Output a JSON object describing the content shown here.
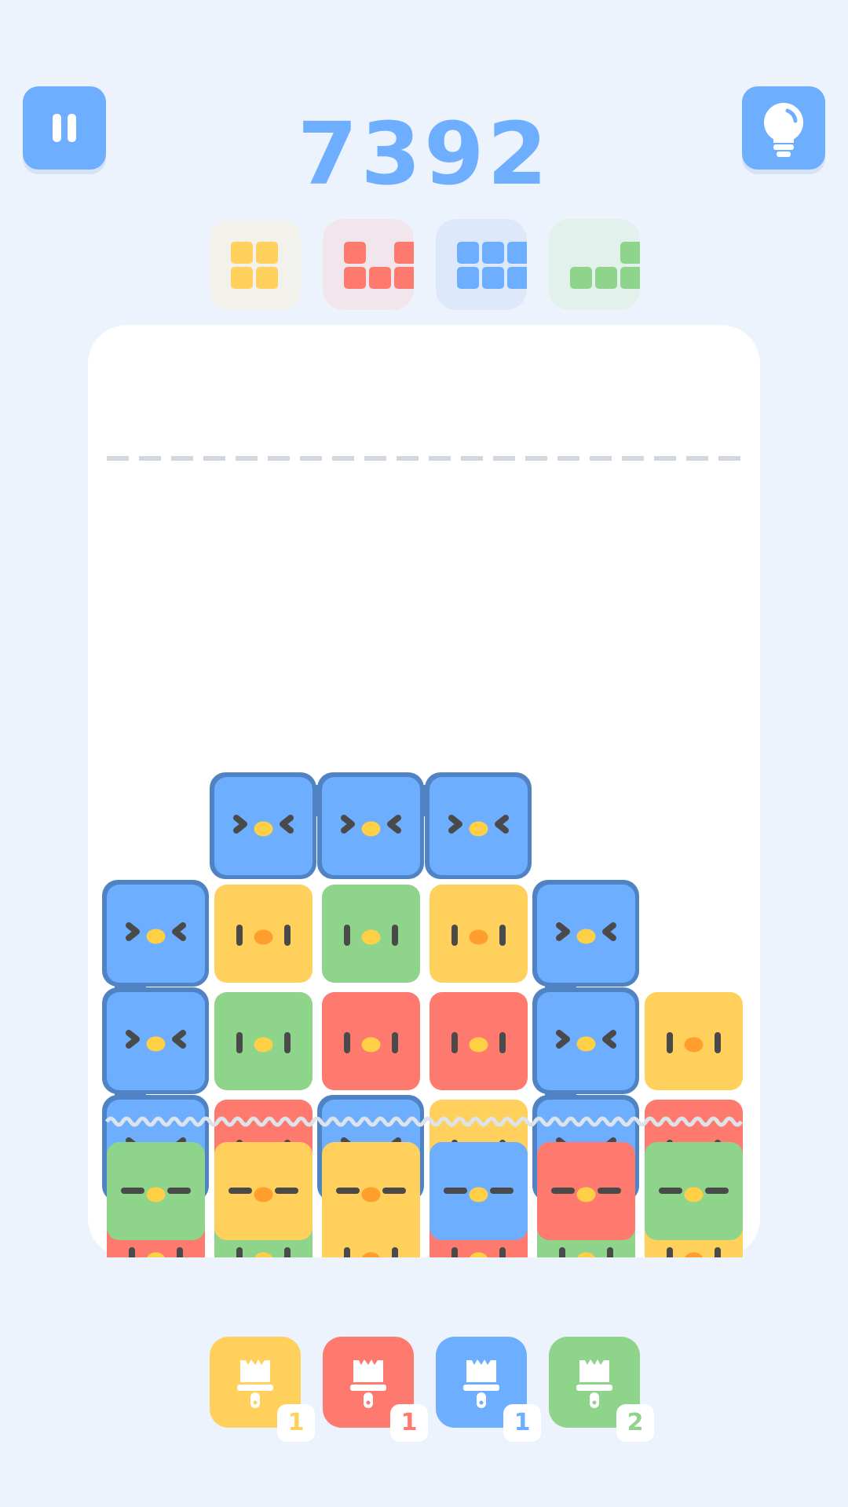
{
  "score": "7392",
  "colors": {
    "yellow": "#ffd05c",
    "red": "#ff7a6e",
    "blue": "#6eaeff",
    "green": "#8ed48a",
    "outline": "#4f83c4",
    "face": "#4a4a4a",
    "nose_yellow": "#ffd045",
    "nose_orange": "#ff9e2c"
  },
  "goals": [
    {
      "name": "yellow",
      "color": "#ffd05c",
      "bg": "#f2f1ec",
      "pattern": [
        [
          1,
          1,
          0
        ],
        [
          1,
          1,
          0
        ]
      ]
    },
    {
      "name": "red",
      "color": "#ff7a6e",
      "bg": "#f0e6ec",
      "pattern": [
        [
          1,
          0,
          1
        ],
        [
          1,
          1,
          1
        ]
      ]
    },
    {
      "name": "blue",
      "color": "#6eaeff",
      "bg": "#dde9fa",
      "pattern": [
        [
          1,
          1,
          1
        ],
        [
          1,
          1,
          1
        ]
      ]
    },
    {
      "name": "green",
      "color": "#8ed48a",
      "bg": "#e3f1ec",
      "pattern": [
        [
          0,
          0,
          1
        ],
        [
          1,
          1,
          1
        ]
      ]
    }
  ],
  "board": {
    "grid": [
      [
        null,
        null,
        null,
        null,
        null,
        null
      ],
      [
        null,
        null,
        null,
        null,
        null,
        null
      ],
      [
        null,
        null,
        null,
        null,
        null,
        null
      ],
      [
        null,
        "B",
        "B",
        "B",
        null,
        null
      ],
      [
        "B",
        "Y",
        "G",
        "Y",
        "B",
        null
      ],
      [
        "B",
        "G",
        "R",
        "R",
        "B",
        "Y"
      ],
      [
        "B",
        "R",
        "B",
        "Y",
        "B",
        "R"
      ],
      [
        "R",
        "G",
        "Y",
        "R",
        "G",
        "Y"
      ]
    ],
    "next_row": [
      "G",
      "Y",
      "Y",
      "B",
      "R",
      "G"
    ]
  },
  "tools": [
    {
      "color": "#ffd05c",
      "count": "1",
      "count_color": "#ffd05c"
    },
    {
      "color": "#ff7a6e",
      "count": "1",
      "count_color": "#ff7a6e"
    },
    {
      "color": "#6eaeff",
      "count": "1",
      "count_color": "#6eaeff"
    },
    {
      "color": "#8ed48a",
      "count": "2",
      "count_color": "#8ed48a"
    }
  ]
}
